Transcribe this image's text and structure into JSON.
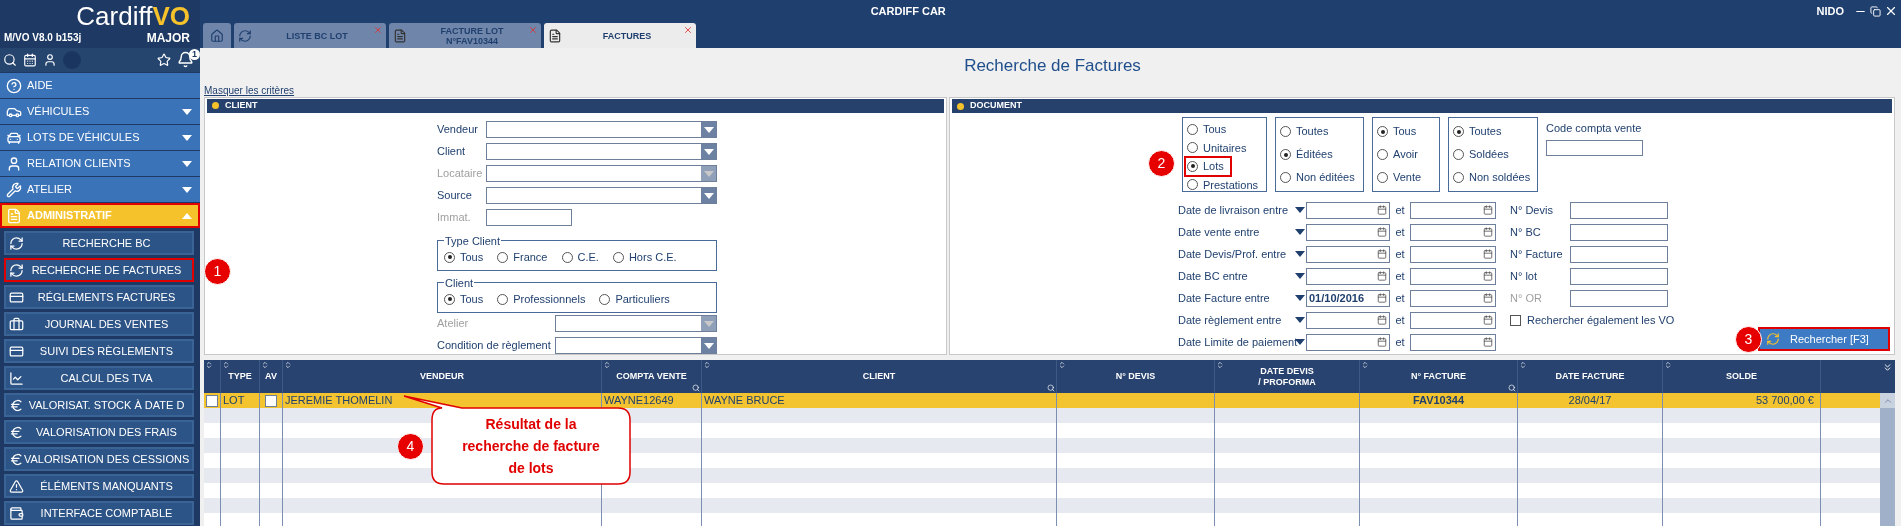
{
  "window": {
    "title": "CARDIFF CAR",
    "user": "NIDO"
  },
  "brand": {
    "name": "Cardiff",
    "accent": "VO",
    "edition": "MAJOR",
    "version": "M/VO V8.0 b153j",
    "alerts": "1"
  },
  "sidebar": {
    "items": [
      {
        "kind": "link",
        "label": "AIDE",
        "annotated": false
      },
      {
        "kind": "section",
        "label": "VÉHICULES",
        "expanded": false,
        "annotated": false
      },
      {
        "kind": "section",
        "label": "LOTS DE VÉHICULES",
        "expanded": false,
        "annotated": false
      },
      {
        "kind": "section",
        "label": "RELATION CLIENTS",
        "expanded": false,
        "annotated": false
      },
      {
        "kind": "section",
        "label": "ATELIER",
        "expanded": false,
        "annotated": false
      },
      {
        "kind": "section",
        "label": "ADMINISTRATIF",
        "expanded": true,
        "annotated": true,
        "children": [
          {
            "label": "RECHERCHE BC",
            "annotated": false
          },
          {
            "label": "RECHERCHE DE FACTURES",
            "annotated": true
          },
          {
            "label": "RÉGLEMENTS FACTURES",
            "annotated": false
          },
          {
            "label": "JOURNAL DES VENTES",
            "annotated": false
          },
          {
            "label": "SUIVI DES RÈGLEMENTS",
            "annotated": false
          },
          {
            "label": "CALCUL DES TVA",
            "annotated": false
          },
          {
            "label": "VALORISAT. STOCK À DATE D",
            "annotated": false
          },
          {
            "label": "VALORISATION DES FRAIS",
            "annotated": false
          },
          {
            "label": "VALORISATION DES CESSIONS",
            "annotated": false
          },
          {
            "label": "ÉLÉMENTS MANQUANTS",
            "annotated": false
          },
          {
            "label": "INTERFACE COMPTABLE",
            "annotated": false
          }
        ]
      }
    ]
  },
  "tabs": [
    {
      "kind": "home",
      "selected": false
    },
    {
      "kind": "search",
      "label": "LISTE BC LOT",
      "selected": false
    },
    {
      "kind": "document",
      "label": "FACTURE LOT\nN°FAV10344",
      "selected": false
    },
    {
      "kind": "document",
      "label": "FACTURES",
      "selected": true
    }
  ],
  "page": {
    "title": "Recherche de Factures",
    "toggle_link": "Masquer les critères"
  },
  "client": {
    "title": "CLIENT",
    "fields": [
      {
        "kind": "select",
        "label": "Vendeur",
        "disabled": false
      },
      {
        "kind": "select",
        "label": "Client",
        "disabled": false
      },
      {
        "kind": "select",
        "label": "Locataire",
        "disabled": true
      },
      {
        "kind": "select",
        "label": "Source",
        "disabled": false
      },
      {
        "kind": "text",
        "label": "Immat.",
        "disabled": true
      },
      {
        "kind": "radio_group",
        "title": "Type Client",
        "options": [
          {
            "label": "Tous",
            "selected": true
          },
          {
            "label": "France",
            "selected": false
          },
          {
            "label": "C.E.",
            "selected": false
          },
          {
            "label": "Hors C.E.",
            "selected": false
          }
        ]
      },
      {
        "kind": "radio_group",
        "title": "Client",
        "options": [
          {
            "label": "Tous",
            "selected": true
          },
          {
            "label": "Professionnels",
            "selected": false
          },
          {
            "label": "Particuliers",
            "selected": false
          }
        ]
      },
      {
        "kind": "select",
        "label": "Atelier",
        "disabled": true
      },
      {
        "kind": "select",
        "label": "Condition de règlement",
        "disabled": false
      }
    ]
  },
  "document": {
    "title": "DOCUMENT",
    "radio_groups": [
      {
        "options": [
          {
            "label": "Tous",
            "selected": false,
            "annotated": false
          },
          {
            "label": "Unitaires",
            "selected": false,
            "annotated": false
          },
          {
            "label": "Lots",
            "selected": true,
            "annotated": true
          },
          {
            "label": "Prestations",
            "selected": false,
            "annotated": false
          }
        ]
      },
      {
        "options": [
          {
            "label": "Toutes",
            "selected": false,
            "annotated": false
          },
          {
            "label": "Éditées",
            "selected": true,
            "annotated": false
          },
          {
            "label": "Non éditées",
            "selected": false,
            "annotated": false
          }
        ]
      },
      {
        "options": [
          {
            "label": "Tous",
            "selected": true,
            "annotated": false
          },
          {
            "label": "Avoir",
            "selected": false,
            "annotated": false
          },
          {
            "label": "Vente",
            "selected": false,
            "annotated": false
          }
        ]
      },
      {
        "options": [
          {
            "label": "Toutes",
            "selected": true,
            "annotated": false
          },
          {
            "label": "Soldées",
            "selected": false,
            "annotated": false
          },
          {
            "label": "Non soldées",
            "selected": false,
            "annotated": false
          }
        ]
      }
    ],
    "code_compta": {
      "label": "Code compta vente"
    },
    "date_rows": [
      {
        "label": "Date de livraison entre",
        "separator": "et"
      },
      {
        "label": "Date vente entre",
        "separator": "et"
      },
      {
        "label": "Date Devis/Prof. entre",
        "separator": "et"
      },
      {
        "label": "Date BC entre",
        "separator": "et"
      },
      {
        "label": "Date Facture entre",
        "from": "01/10/2016",
        "separator": "et"
      },
      {
        "label": "Date règlement entre",
        "separator": "et"
      },
      {
        "label": "Date Limite de paiement",
        "separator": "et"
      }
    ],
    "number_fields": [
      {
        "label": "N° Devis",
        "disabled": false
      },
      {
        "label": "N° BC",
        "disabled": false
      },
      {
        "label": "N° Facture",
        "disabled": false
      },
      {
        "label": "N° lot",
        "disabled": false
      },
      {
        "label": "N° OR",
        "disabled": true
      }
    ],
    "also_vo": {
      "label": "Rechercher également les VO",
      "checked": false
    },
    "search_button": {
      "label": "Rechercher [F3]",
      "annotated": true
    }
  },
  "table": {
    "columns": [
      {
        "kind": "check",
        "filterable": false
      },
      {
        "kind": "text",
        "label": "TYPE",
        "filterable": false
      },
      {
        "kind": "check",
        "label": "AV",
        "filterable": false
      },
      {
        "kind": "text",
        "label": "VENDEUR",
        "filterable": false
      },
      {
        "kind": "text",
        "label": "COMPTA VENTE",
        "filterable": true
      },
      {
        "kind": "text",
        "label": "CLIENT",
        "filterable": true
      },
      {
        "kind": "text",
        "label": "N° DEVIS",
        "filterable": false
      },
      {
        "kind": "text",
        "label": "DATE DEVIS\n/ PROFORMA",
        "filterable": false
      },
      {
        "kind": "text",
        "label": "N° FACTURE",
        "filterable": true
      },
      {
        "kind": "text",
        "label": "DATE FACTURE",
        "filterable": false
      },
      {
        "kind": "text",
        "label": "SOLDE",
        "filterable": false
      }
    ],
    "rows": [
      {
        "selected": true,
        "checked": false,
        "type": "LOT",
        "avoir": false,
        "vendeur": "JEREMIE THOMELIN",
        "compta_vente": "WAYNE12649",
        "client": "WAYNE BRUCE",
        "facture": "FAV10344",
        "date_facture": "28/04/17",
        "solde": "53 700,00 €"
      }
    ]
  },
  "annotations": {
    "markers": [
      "1",
      "2",
      "3",
      "4"
    ],
    "callout": "Résultat de la recherche de facture de lots"
  }
}
